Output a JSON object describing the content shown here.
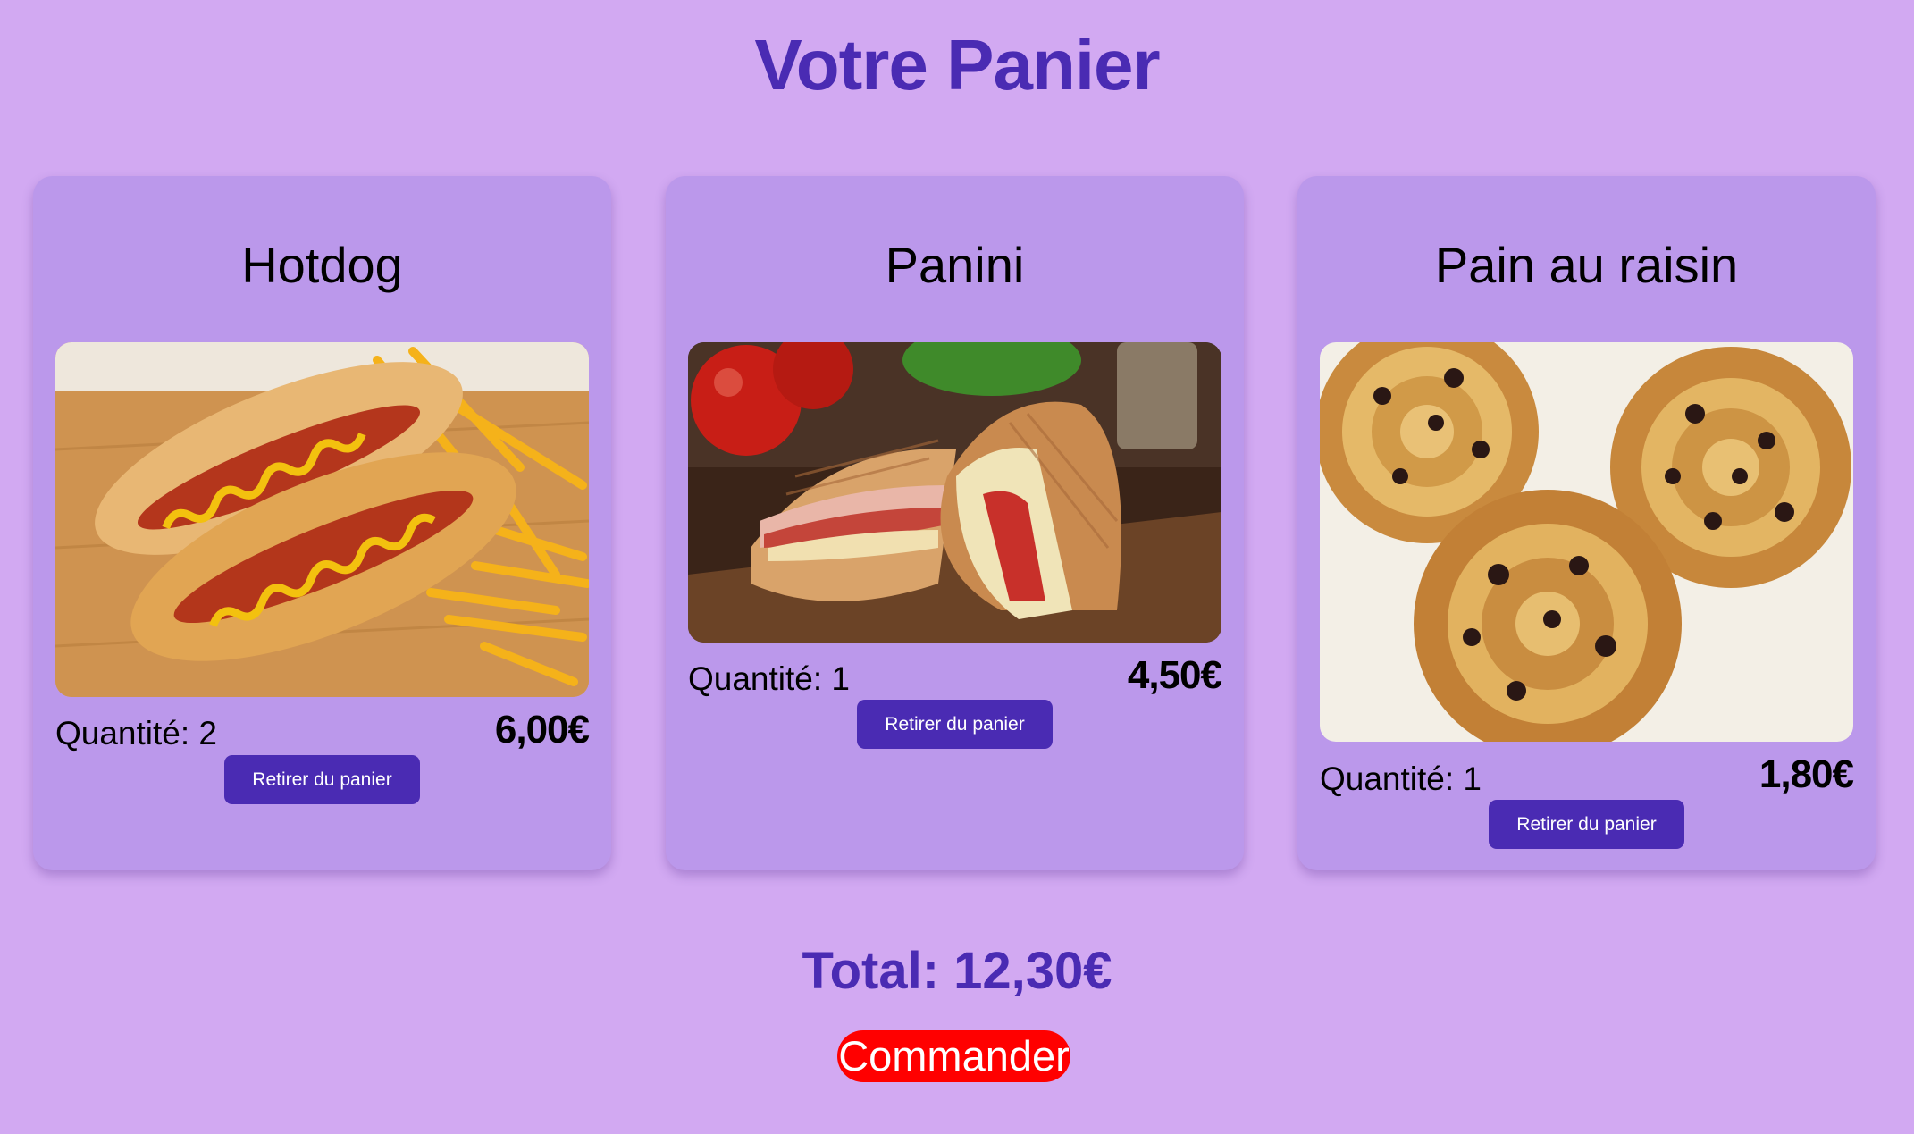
{
  "page": {
    "title": "Votre Panier"
  },
  "cart": {
    "items": [
      {
        "name": "Hotdog",
        "quantity_label": "Quantité: 2",
        "price": "6,00€",
        "remove_label": "Retirer du panier"
      },
      {
        "name": "Panini",
        "quantity_label": "Quantité: 1",
        "price": "4,50€",
        "remove_label": "Retirer du panier"
      },
      {
        "name": "Pain au raisin",
        "quantity_label": "Quantité: 1",
        "price": "1,80€",
        "remove_label": "Retirer du panier"
      }
    ],
    "total_label": "Total: 12,30€",
    "order_label": "Commander"
  },
  "colors": {
    "background": "#d2a9f2",
    "card": "#bb98eb",
    "accent": "#4a2bb3",
    "order_button": "#ff0000"
  }
}
